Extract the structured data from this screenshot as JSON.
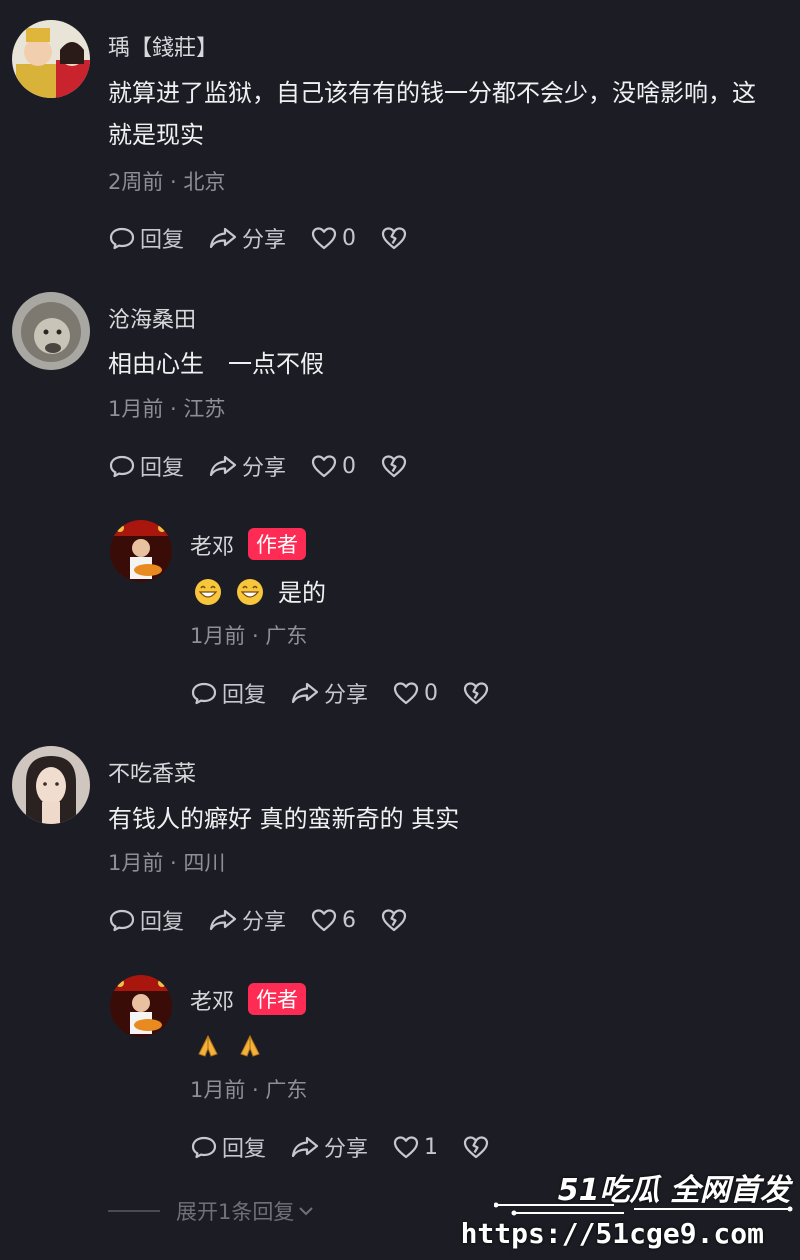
{
  "comments": [
    {
      "username": "瑀【錢莊】",
      "text": "就算进了监狱，自己该有有的钱一分都不会少，没啥影响，这就是现实",
      "meta": "2周前 · 北京",
      "reply_label": "回复",
      "share_label": "分享",
      "likes": "0"
    },
    {
      "username": "沧海桑田",
      "text": "相由心生　一点不假",
      "meta": "1月前 · 江苏",
      "reply_label": "回复",
      "share_label": "分享",
      "likes": "0"
    },
    {
      "username": "老邓",
      "badge": "作者",
      "text": "是的",
      "emoji": "grinning-face-emoji",
      "meta": "1月前 · 广东",
      "reply_label": "回复",
      "share_label": "分享",
      "likes": "0"
    },
    {
      "username": "不吃香菜",
      "text": "有钱人的癖好 真的蛮新奇的 其实",
      "meta": "1月前 · 四川",
      "reply_label": "回复",
      "share_label": "分享",
      "likes": "6"
    },
    {
      "username": "老邓",
      "badge": "作者",
      "text": "",
      "emoji": "folded-hands-emoji",
      "meta": "1月前 · 广东",
      "reply_label": "回复",
      "share_label": "分享",
      "likes": "1"
    }
  ],
  "expand_label": "展开1条回复",
  "watermark": {
    "brand": "51吃瓜 全网首发",
    "url": "https://51cge9.com"
  },
  "colors": {
    "background": "#1c1d24",
    "author_badge": "#fe2c55",
    "meta": "#8d8e96"
  }
}
